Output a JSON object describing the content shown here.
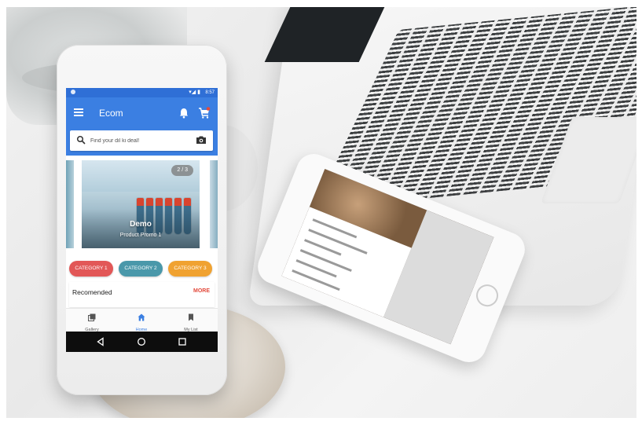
{
  "app": {
    "title": "Ecom",
    "status_time": "8:57",
    "status_icons": "▾◢ ▮"
  },
  "search": {
    "placeholder": "Find your dil ki deal!"
  },
  "carousel": {
    "counter": "2 / 3",
    "slide_title": "Demo",
    "slide_subtitle": "Product Promo 1"
  },
  "categories": [
    {
      "label": "CATEGORY 1",
      "color": "#e25757"
    },
    {
      "label": "CATEGORY 2",
      "color": "#4a98aa"
    },
    {
      "label": "CATEGORY 3",
      "color": "#f0a231"
    }
  ],
  "section": {
    "title": "Recomended",
    "more": "MORE"
  },
  "bottom_nav": [
    {
      "label": "Gallery",
      "icon": "gallery-icon"
    },
    {
      "label": "Home",
      "icon": "home-icon"
    },
    {
      "label": "My List",
      "icon": "bookmark-icon"
    }
  ],
  "system_nav": [
    "back-icon",
    "home-circle-icon",
    "recents-icon"
  ],
  "colors": {
    "primary": "#3b7fe2",
    "primary_dark": "#2f6fd6",
    "accent_more": "#e34a3c"
  }
}
